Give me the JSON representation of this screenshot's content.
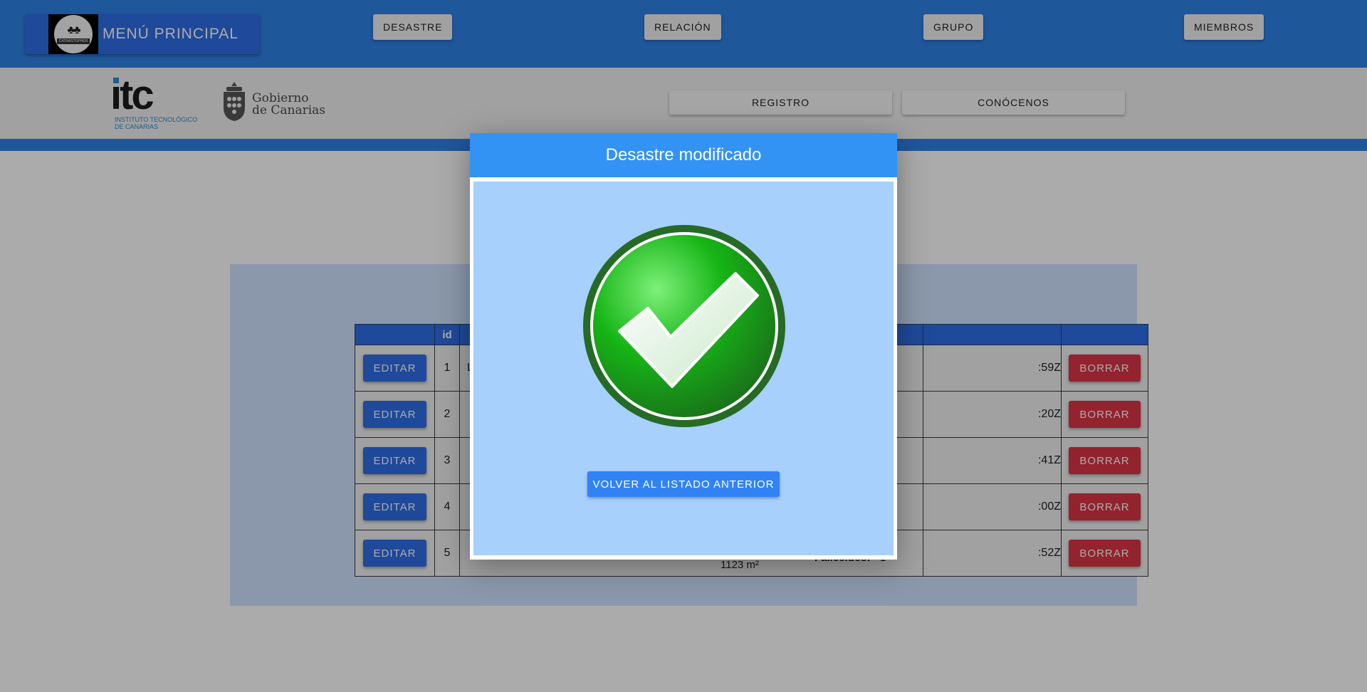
{
  "navbar": {
    "brand_title": "MENÚ PRINCIPAL",
    "brand_logo_caption": "CATRASTOPHER",
    "items": [
      {
        "label": "DESASTRE"
      },
      {
        "label": "RELACIÓN"
      },
      {
        "label": "GRUPO"
      },
      {
        "label": "MIEMBROS"
      }
    ]
  },
  "subheader": {
    "itc_logo_text": "itc",
    "itc_logo_subtitle_line1": "INSTITUTO TECNOLÓGICO",
    "itc_logo_subtitle_line2": "DE CANARIAS",
    "gobierno_line1": "Gobierno",
    "gobierno_line2": "de Canarias",
    "register_label": "REGISTRO",
    "about_label": "CONÓCENOS"
  },
  "table": {
    "header_id": "id",
    "edit_label": "EDITAR",
    "delete_label": "BORRAR",
    "rows": [
      {
        "id": "1",
        "first_letter": "L",
        "date_suffix": ":59Z"
      },
      {
        "id": "2",
        "first_letter": "",
        "date_suffix": ":20Z"
      },
      {
        "id": "3",
        "first_letter": "",
        "date_suffix": ":41Z"
      },
      {
        "id": "4",
        "first_letter": "",
        "date_suffix": ":00Z"
      },
      {
        "id": "5",
        "first_letter": "",
        "date_suffix": ":52Z",
        "area": "1123 m²",
        "fallecidos_label": "Fallecidos:",
        "fallecidos_value": "1"
      }
    ]
  },
  "modal": {
    "title": "Desastre modificado",
    "back_button": "VOLVER AL LISTADO ANTERIOR"
  },
  "colors": {
    "navbar": "#2f82e8",
    "brand": "#2f6ee6",
    "modal_header": "#3393f5",
    "modal_body": "#a7d0fd",
    "delete": "#dc3545",
    "check_green": "#22a322"
  }
}
